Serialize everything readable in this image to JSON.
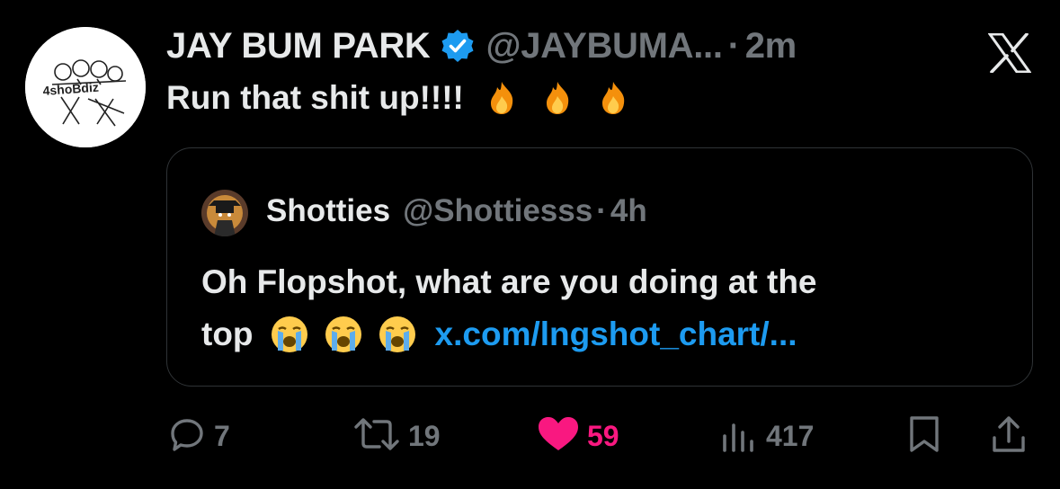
{
  "post": {
    "author_name": "JAY BUM PARK",
    "author_handle": "@JAYBUMA...",
    "separator": "·",
    "time": "2m",
    "text": "Run that shit up!!!!",
    "avatar_text": "4shoBdiz"
  },
  "quote": {
    "author_name": "Shotties",
    "author_handle": "@Shottiesss",
    "separator": "·",
    "time": "4h",
    "line1": "Oh Flopshot, what are you doing at the",
    "line2_text": "top",
    "link": "x.com/lngshot_chart/..."
  },
  "actions": {
    "replies": "7",
    "reposts": "19",
    "likes": "59",
    "views": "417"
  },
  "icons": {
    "brand": "x-logo-icon",
    "verified": "verified-badge-icon",
    "fire": "fire-emoji-icon",
    "crying": "loudly-crying-face-emoji-icon",
    "reply": "reply-icon",
    "repost": "repost-icon",
    "like": "heart-icon",
    "views": "views-chart-icon",
    "bookmark": "bookmark-icon",
    "share": "share-icon"
  },
  "colors": {
    "background": "#000000",
    "text": "#e7e9ea",
    "muted": "#71767b",
    "link": "#1d9bf0",
    "like": "#f91880",
    "verified": "#1d9bf0",
    "border": "#2f3336"
  }
}
